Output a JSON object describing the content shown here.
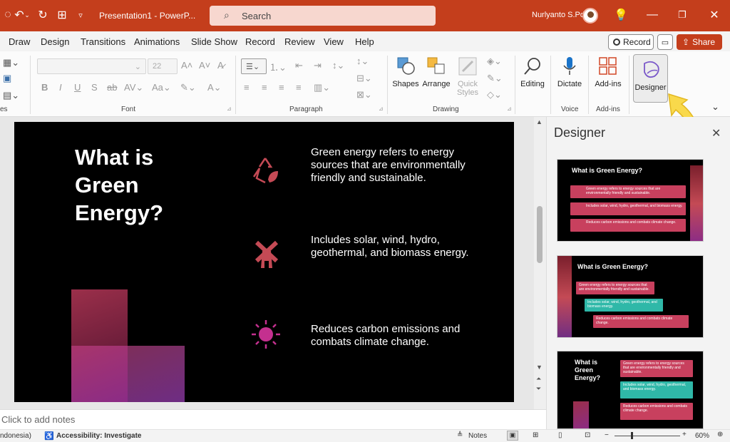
{
  "titlebar": {
    "doc_title": "Presentation1  -  PowerP...",
    "search_placeholder": "Search",
    "user_name": "Nurlyanto S.Pd"
  },
  "menu": {
    "items": [
      "Draw",
      "Design",
      "Transitions",
      "Animations",
      "Slide Show",
      "Record",
      "Review",
      "View",
      "Help"
    ],
    "record_button": "Record",
    "share_button": "Share"
  },
  "ribbon": {
    "font_size": "22",
    "groups": {
      "font": "Font",
      "paragraph": "Paragraph",
      "drawing": "Drawing",
      "voice": "Voice",
      "addins": "Add-ins"
    },
    "buttons": {
      "shapes": "Shapes",
      "arrange": "Arrange",
      "quick_styles_1": "Quick",
      "quick_styles_2": "Styles",
      "editing": "Editing",
      "dictate": "Dictate",
      "addins": "Add-ins",
      "designer": "Designer"
    }
  },
  "slide": {
    "title": "What is Green Energy?",
    "points": [
      "Green energy refers to energy sources that are environmentally friendly and sustainable.",
      "Includes solar, wind, hydro, geothermal, and biomass energy.",
      "Reduces carbon emissions and combats climate change."
    ],
    "icons": [
      "recycle-leaf-icon",
      "windmill-icon",
      "sun-icon"
    ]
  },
  "notes": {
    "placeholder": "Click to add notes"
  },
  "status": {
    "language": "ndonesia)",
    "accessibility": "Accessibility: Investigate",
    "notes": "Notes",
    "zoom": "60%"
  },
  "designer": {
    "title": "Designer",
    "thumb1": {
      "title": "What is Green Energy?",
      "items": [
        "Green energy refers to energy sources that are environmentally friendly and sustainable.",
        "Includes solar, wind, hydro, geothermal, and biomass energy.",
        "Reduces carbon emissions and combats climate change."
      ]
    },
    "thumb2": {
      "title": "What is Green Energy?",
      "items": [
        "Green energy refers to energy sources that are environmentally friendly and sustainable.",
        "Includes solar, wind, hydro, geothermal, and biomass energy.",
        "Reduces carbon emissions and combats climate change."
      ]
    },
    "thumb3": {
      "title": "What is Green Energy?",
      "items": [
        "Green energy refers to energy sources that are environmentally friendly and sustainable.",
        "Includes solar, wind, hydro, geothermal, and biomass energy.",
        "Reduces carbon emissions and combats climate change."
      ]
    }
  },
  "colors": {
    "brand": "#c43e1c",
    "icon_red": "#c44a55",
    "icon_magenta": "#c4308f",
    "box_pink": "#c8405e",
    "box_teal": "#2fb8a8"
  }
}
